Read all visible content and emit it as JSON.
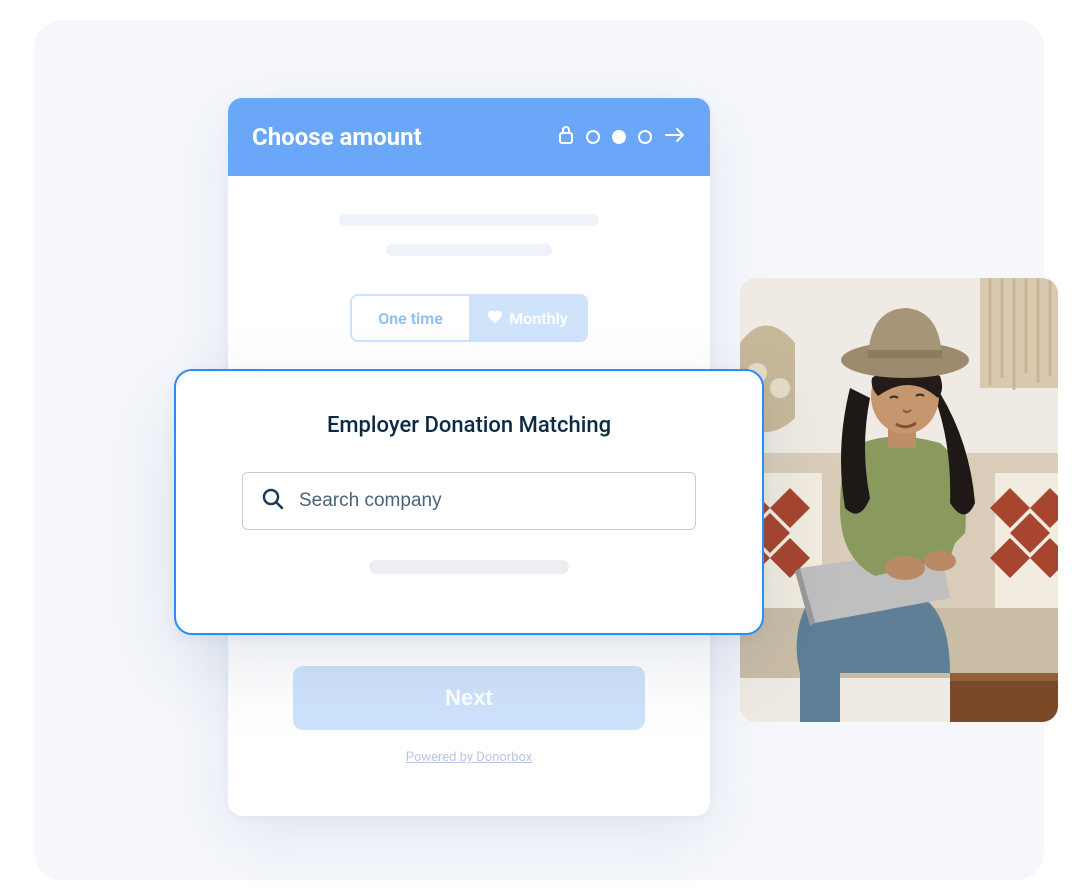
{
  "header": {
    "title": "Choose amount"
  },
  "frequency": {
    "onetime": "One time",
    "monthly": "Monthly"
  },
  "buttons": {
    "next": "Next"
  },
  "footer": {
    "powered": "Powered by Donorbox"
  },
  "modal": {
    "title": "Employer Donation Matching",
    "search_placeholder": "Search company"
  }
}
